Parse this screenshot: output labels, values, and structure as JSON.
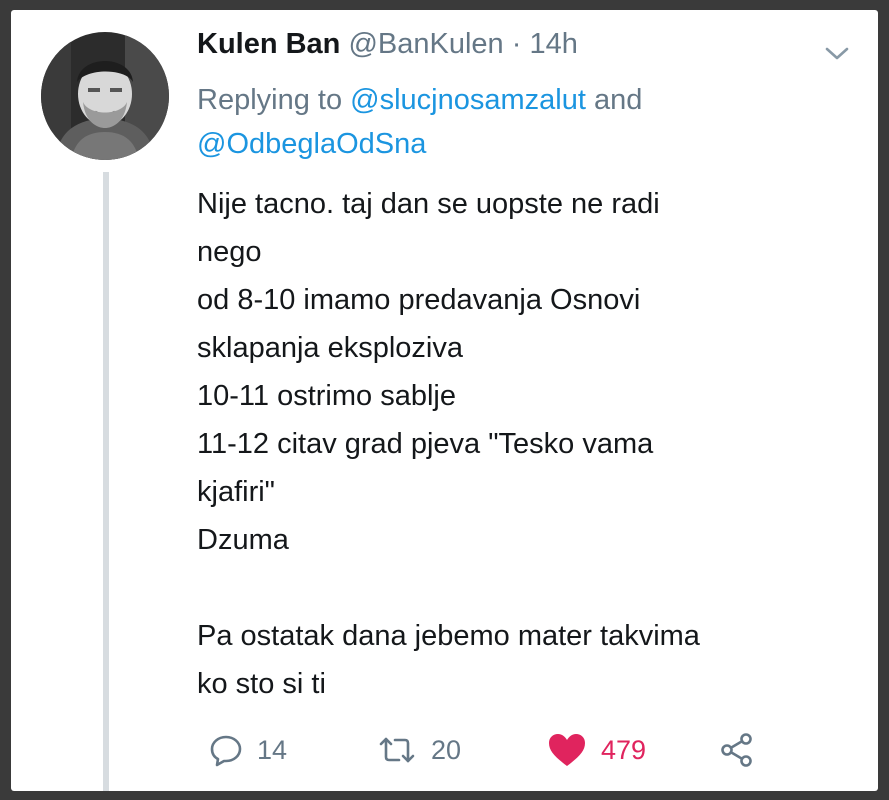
{
  "tweet": {
    "author_name": "Kulen Ban",
    "author_handle": "@BanKulen",
    "separator": "·",
    "time": "14h",
    "reply_prefix": "Replying to",
    "reply_mention_1": "@slucjnosamzalut",
    "reply_and": "and",
    "reply_mention_2": "@OdbeglaOdSna",
    "body_lines": [
      "Nije tacno. taj dan se uopste ne radi",
      "nego",
      "od 8-10 imamo predavanja Osnovi",
      "sklapanja eksploziva",
      "10-11 ostrimo sablje",
      "11-12 citav grad pjeva \"Tesko vama",
      "kjafiri\"",
      "Dzuma",
      "",
      "Pa ostatak dana jebemo mater takvima",
      "ko sto si ti"
    ],
    "actions": {
      "reply_count": "14",
      "retweet_count": "20",
      "like_count": "479"
    }
  },
  "icons": {
    "reply": "comment-bubble-icon",
    "retweet": "retweet-icon",
    "like": "heart-icon",
    "share": "share-icon",
    "menu": "chevron-down-icon"
  },
  "colors": {
    "text": "#14171a",
    "secondary": "#657786",
    "link": "#1b95e0",
    "like": "#e0245e",
    "thread_line": "#d7dce0"
  }
}
